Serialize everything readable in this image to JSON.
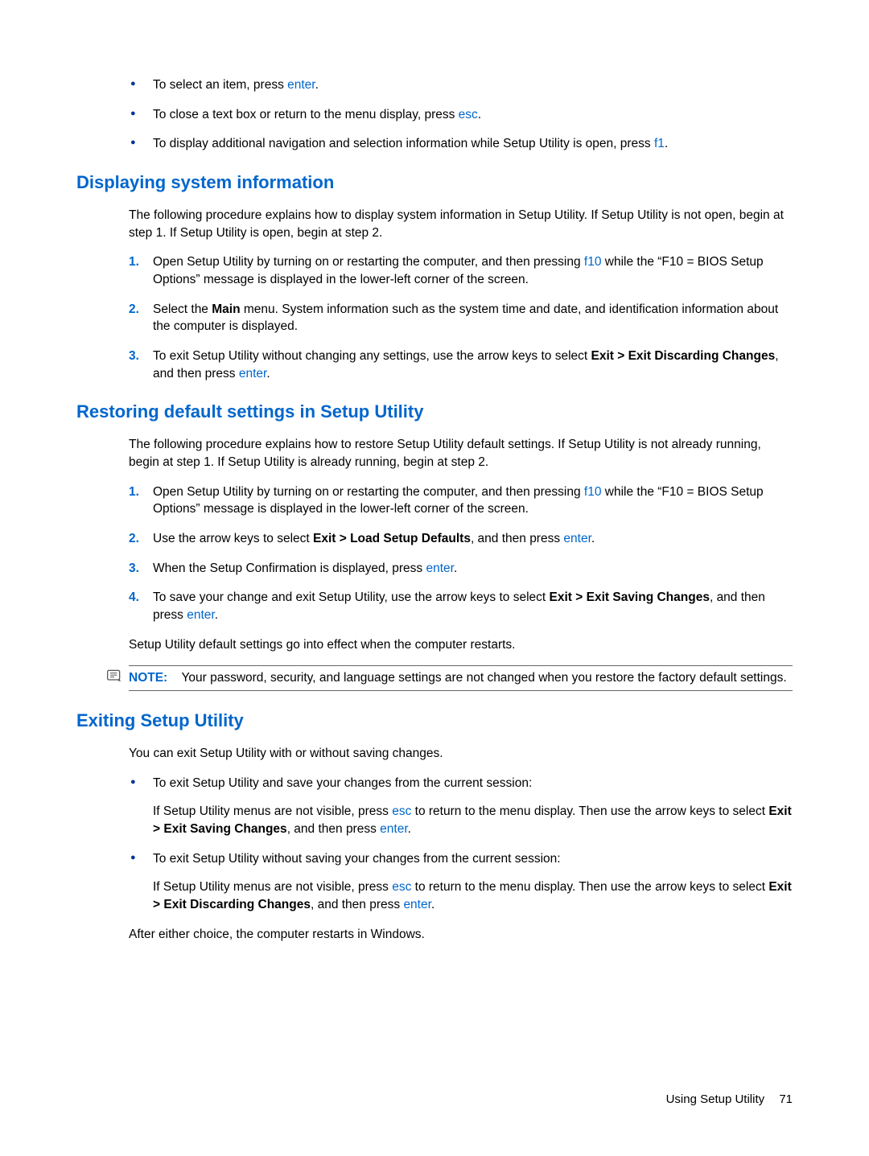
{
  "intro_bullets": [
    {
      "pre": "To select an item, press ",
      "key": "enter",
      "post": "."
    },
    {
      "pre": "To close a text box or return to the menu display, press ",
      "key": "esc",
      "post": "."
    },
    {
      "pre": "To display additional navigation and selection information while Setup Utility is open, press ",
      "key": "f1",
      "post": "."
    }
  ],
  "section1": {
    "heading": "Displaying system information",
    "intro": "The following procedure explains how to display system information in Setup Utility. If Setup Utility is not open, begin at step 1. If Setup Utility is open, begin at step 2.",
    "step1_pre": "Open Setup Utility by turning on or restarting the computer, and then pressing ",
    "step1_key": "f10",
    "step1_post": " while the “F10 = BIOS Setup Options” message is displayed in the lower-left corner of the screen.",
    "step2_pre": "Select the ",
    "step2_bold": "Main",
    "step2_post": " menu. System information such as the system time and date, and identification information about the computer is displayed.",
    "step3_pre": "To exit Setup Utility without changing any settings, use the arrow keys to select ",
    "step3_bold": "Exit > Exit Discarding Changes",
    "step3_mid": ", and then press ",
    "step3_key": "enter",
    "step3_end": "."
  },
  "section2": {
    "heading": "Restoring default settings in Setup Utility",
    "intro": "The following procedure explains how to restore Setup Utility default settings. If Setup Utility is not already running, begin at step 1. If Setup Utility is already running, begin at step 2.",
    "step1_pre": "Open Setup Utility by turning on or restarting the computer, and then pressing ",
    "step1_key": "f10",
    "step1_post": " while the “F10 = BIOS Setup Options” message is displayed in the lower-left corner of the screen.",
    "step2_pre": "Use the arrow keys to select ",
    "step2_bold": "Exit > Load Setup Defaults",
    "step2_mid": ", and then press ",
    "step2_key": "enter",
    "step2_end": ".",
    "step3_pre": "When the Setup Confirmation is displayed, press ",
    "step3_key": "enter",
    "step3_end": ".",
    "step4_pre": "To save your change and exit Setup Utility, use the arrow keys to select ",
    "step4_bold": "Exit > Exit Saving Changes",
    "step4_mid": ", and then press ",
    "step4_key": "enter",
    "step4_end": ".",
    "after": "Setup Utility default settings go into effect when the computer restarts.",
    "note_label": "NOTE:",
    "note_text": "Your password, security, and language settings are not changed when you restore the factory default settings."
  },
  "section3": {
    "heading": "Exiting Setup Utility",
    "intro": "You can exit Setup Utility with or without saving changes.",
    "b1_text": "To exit Setup Utility and save your changes from the current session:",
    "b1_sub_pre": "If Setup Utility menus are not visible, press ",
    "b1_sub_key1": "esc",
    "b1_sub_mid": " to return to the menu display. Then use the arrow keys to select ",
    "b1_sub_bold": "Exit > Exit Saving Changes",
    "b1_sub_mid2": ", and then press ",
    "b1_sub_key2": "enter",
    "b1_sub_end": ".",
    "b2_text": "To exit Setup Utility without saving your changes from the current session:",
    "b2_sub_pre": "If Setup Utility menus are not visible, press ",
    "b2_sub_key1": "esc",
    "b2_sub_mid": " to return to the menu display. Then use the arrow keys to select ",
    "b2_sub_bold": "Exit > Exit Discarding Changes",
    "b2_sub_mid2": ", and then press ",
    "b2_sub_key2": "enter",
    "b2_sub_end": ".",
    "after": "After either choice, the computer restarts in Windows."
  },
  "footer": {
    "text": "Using Setup Utility",
    "page": "71"
  }
}
